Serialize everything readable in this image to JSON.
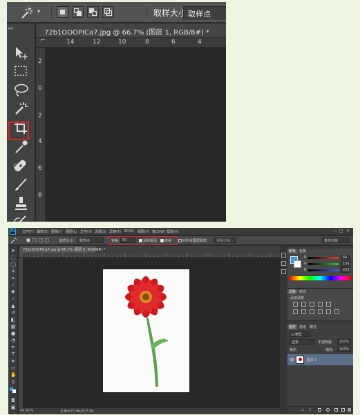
{
  "top": {
    "options": {
      "dropdown_arrow": "▾",
      "sample_size_label": "取样大小:",
      "sample_size_value": "取样点"
    },
    "toolbar_grip": "▸▸",
    "document_tab": "72b1OOOPICa7.jpg @ 66.7% (图层 1, RGB/8#) *",
    "ruler_h": [
      "14",
      "12",
      "10",
      "8",
      "6",
      "4"
    ],
    "ruler_v": [
      "2",
      "0",
      "2",
      "4",
      "6",
      "8"
    ],
    "tools": [
      "move-tool-icon",
      "marquee-tool-icon",
      "lasso-tool-icon",
      "magic-wand-tool-icon",
      "crop-tool-icon",
      "eyedropper-tool-icon",
      "healing-brush-tool-icon",
      "brush-tool-icon",
      "clone-stamp-tool-icon",
      "history-brush-tool-icon"
    ],
    "highlight_color": "#d4262c"
  },
  "bottom": {
    "app_logo": "Ps",
    "menu": [
      "文件(F)",
      "编辑(E)",
      "图像(I)",
      "图层(L)",
      "文字(Y)",
      "选择(S)",
      "滤镜(T)",
      "3D(D)",
      "视图(V)",
      "窗口(W)",
      "帮助(H)"
    ],
    "window_controls": [
      "—",
      "□",
      "✕"
    ],
    "options": {
      "sample_size_label": "取样大小:",
      "sample_size_value": "取样点",
      "tolerance_label": "容差:",
      "tolerance_value": "50",
      "antialias_label": "消除锯齿",
      "contiguous_label": "连续",
      "all_layers_label": "对所有图层取样",
      "refine_edge_button": "调整边缘...",
      "workspace": "基本功能"
    },
    "document_tab": "72b1OOOPICa7.jpg @ 66.7% (图层 0, RGB/8#) *",
    "status_zoom": "66.67%",
    "status_doc": "文档:877.9K/877.9K",
    "panels": {
      "color_tabs": [
        "颜色",
        "色板"
      ],
      "rgb": [
        {
          "channel": "R",
          "value": "56",
          "color": "#e04040"
        },
        {
          "channel": "G",
          "value": "155",
          "color": "#40c040"
        },
        {
          "channel": "B",
          "value": "223",
          "color": "#4060e0"
        }
      ],
      "foreground_color": "#389bdf",
      "adjust_tabs": [
        "调整",
        "样式"
      ],
      "adjust_title": "添加调整",
      "layers_tabs": [
        "图层",
        "通道",
        "路径"
      ],
      "kind_label": "ρ 类型",
      "blend_mode": "正常",
      "opacity_label": "不透明度:",
      "opacity_value": "100%",
      "lock_label": "锁定:",
      "fill_label": "填充:",
      "fill_value": "100%",
      "layer_name": "图层 0"
    }
  }
}
